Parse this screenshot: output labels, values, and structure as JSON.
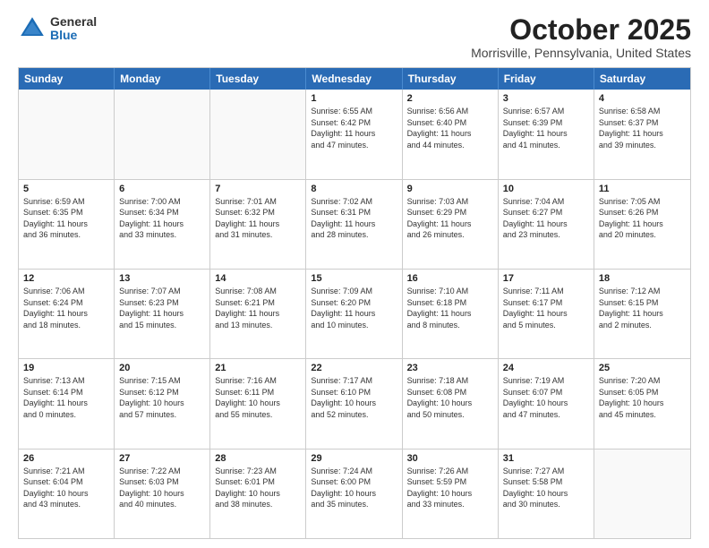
{
  "logo": {
    "general": "General",
    "blue": "Blue"
  },
  "header": {
    "month": "October 2025",
    "location": "Morrisville, Pennsylvania, United States"
  },
  "weekdays": [
    "Sunday",
    "Monday",
    "Tuesday",
    "Wednesday",
    "Thursday",
    "Friday",
    "Saturday"
  ],
  "rows": [
    [
      {
        "day": "",
        "text": ""
      },
      {
        "day": "",
        "text": ""
      },
      {
        "day": "",
        "text": ""
      },
      {
        "day": "1",
        "text": "Sunrise: 6:55 AM\nSunset: 6:42 PM\nDaylight: 11 hours\nand 47 minutes."
      },
      {
        "day": "2",
        "text": "Sunrise: 6:56 AM\nSunset: 6:40 PM\nDaylight: 11 hours\nand 44 minutes."
      },
      {
        "day": "3",
        "text": "Sunrise: 6:57 AM\nSunset: 6:39 PM\nDaylight: 11 hours\nand 41 minutes."
      },
      {
        "day": "4",
        "text": "Sunrise: 6:58 AM\nSunset: 6:37 PM\nDaylight: 11 hours\nand 39 minutes."
      }
    ],
    [
      {
        "day": "5",
        "text": "Sunrise: 6:59 AM\nSunset: 6:35 PM\nDaylight: 11 hours\nand 36 minutes."
      },
      {
        "day": "6",
        "text": "Sunrise: 7:00 AM\nSunset: 6:34 PM\nDaylight: 11 hours\nand 33 minutes."
      },
      {
        "day": "7",
        "text": "Sunrise: 7:01 AM\nSunset: 6:32 PM\nDaylight: 11 hours\nand 31 minutes."
      },
      {
        "day": "8",
        "text": "Sunrise: 7:02 AM\nSunset: 6:31 PM\nDaylight: 11 hours\nand 28 minutes."
      },
      {
        "day": "9",
        "text": "Sunrise: 7:03 AM\nSunset: 6:29 PM\nDaylight: 11 hours\nand 26 minutes."
      },
      {
        "day": "10",
        "text": "Sunrise: 7:04 AM\nSunset: 6:27 PM\nDaylight: 11 hours\nand 23 minutes."
      },
      {
        "day": "11",
        "text": "Sunrise: 7:05 AM\nSunset: 6:26 PM\nDaylight: 11 hours\nand 20 minutes."
      }
    ],
    [
      {
        "day": "12",
        "text": "Sunrise: 7:06 AM\nSunset: 6:24 PM\nDaylight: 11 hours\nand 18 minutes."
      },
      {
        "day": "13",
        "text": "Sunrise: 7:07 AM\nSunset: 6:23 PM\nDaylight: 11 hours\nand 15 minutes."
      },
      {
        "day": "14",
        "text": "Sunrise: 7:08 AM\nSunset: 6:21 PM\nDaylight: 11 hours\nand 13 minutes."
      },
      {
        "day": "15",
        "text": "Sunrise: 7:09 AM\nSunset: 6:20 PM\nDaylight: 11 hours\nand 10 minutes."
      },
      {
        "day": "16",
        "text": "Sunrise: 7:10 AM\nSunset: 6:18 PM\nDaylight: 11 hours\nand 8 minutes."
      },
      {
        "day": "17",
        "text": "Sunrise: 7:11 AM\nSunset: 6:17 PM\nDaylight: 11 hours\nand 5 minutes."
      },
      {
        "day": "18",
        "text": "Sunrise: 7:12 AM\nSunset: 6:15 PM\nDaylight: 11 hours\nand 2 minutes."
      }
    ],
    [
      {
        "day": "19",
        "text": "Sunrise: 7:13 AM\nSunset: 6:14 PM\nDaylight: 11 hours\nand 0 minutes."
      },
      {
        "day": "20",
        "text": "Sunrise: 7:15 AM\nSunset: 6:12 PM\nDaylight: 10 hours\nand 57 minutes."
      },
      {
        "day": "21",
        "text": "Sunrise: 7:16 AM\nSunset: 6:11 PM\nDaylight: 10 hours\nand 55 minutes."
      },
      {
        "day": "22",
        "text": "Sunrise: 7:17 AM\nSunset: 6:10 PM\nDaylight: 10 hours\nand 52 minutes."
      },
      {
        "day": "23",
        "text": "Sunrise: 7:18 AM\nSunset: 6:08 PM\nDaylight: 10 hours\nand 50 minutes."
      },
      {
        "day": "24",
        "text": "Sunrise: 7:19 AM\nSunset: 6:07 PM\nDaylight: 10 hours\nand 47 minutes."
      },
      {
        "day": "25",
        "text": "Sunrise: 7:20 AM\nSunset: 6:05 PM\nDaylight: 10 hours\nand 45 minutes."
      }
    ],
    [
      {
        "day": "26",
        "text": "Sunrise: 7:21 AM\nSunset: 6:04 PM\nDaylight: 10 hours\nand 43 minutes."
      },
      {
        "day": "27",
        "text": "Sunrise: 7:22 AM\nSunset: 6:03 PM\nDaylight: 10 hours\nand 40 minutes."
      },
      {
        "day": "28",
        "text": "Sunrise: 7:23 AM\nSunset: 6:01 PM\nDaylight: 10 hours\nand 38 minutes."
      },
      {
        "day": "29",
        "text": "Sunrise: 7:24 AM\nSunset: 6:00 PM\nDaylight: 10 hours\nand 35 minutes."
      },
      {
        "day": "30",
        "text": "Sunrise: 7:26 AM\nSunset: 5:59 PM\nDaylight: 10 hours\nand 33 minutes."
      },
      {
        "day": "31",
        "text": "Sunrise: 7:27 AM\nSunset: 5:58 PM\nDaylight: 10 hours\nand 30 minutes."
      },
      {
        "day": "",
        "text": ""
      }
    ]
  ]
}
